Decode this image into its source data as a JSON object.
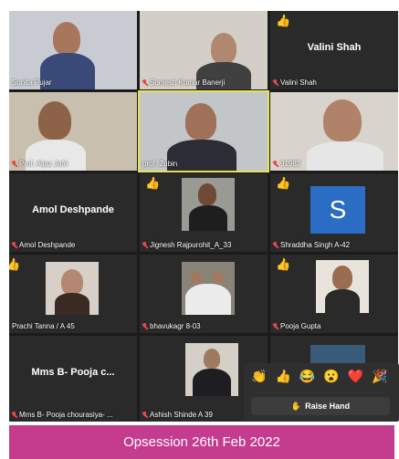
{
  "tiles": [
    {
      "name": "Sunita Pujar"
    },
    {
      "name": "Somesh Kumar Banerji"
    },
    {
      "name": "Valini Shah",
      "center": "Valini Shah"
    },
    {
      "name": "Prof. Aijaz Jafri"
    },
    {
      "name": "prof. Zubin"
    },
    {
      "name": "91982"
    },
    {
      "name": "Amol Deshpande",
      "center": "Amol Deshpande"
    },
    {
      "name": "Jignesh Rajpurohit_A_33"
    },
    {
      "name": "Shraddha Singh A-42",
      "avatar": "S"
    },
    {
      "name": "Prachi Tanna / A 45"
    },
    {
      "name": "bhavukagr 8-03"
    },
    {
      "name": "Pooja Gupta"
    },
    {
      "name": "Mms B- Pooja chourasiya- ...",
      "center": "Mms B- Pooja c..."
    },
    {
      "name": "Ashish Shinde A 39"
    }
  ],
  "reactions": {
    "emojis": [
      "👏",
      "👍",
      "😂",
      "😮",
      "❤️",
      "🎉"
    ],
    "raise_hand_label": "Raise Hand"
  },
  "banner": {
    "text": "Opsession 26th Feb 2022"
  },
  "colors": {
    "banner": "#c43c8e",
    "tile_bg": "#2a2a2a",
    "mic_muted": "#e34a4a",
    "hand": "#f5c400"
  }
}
